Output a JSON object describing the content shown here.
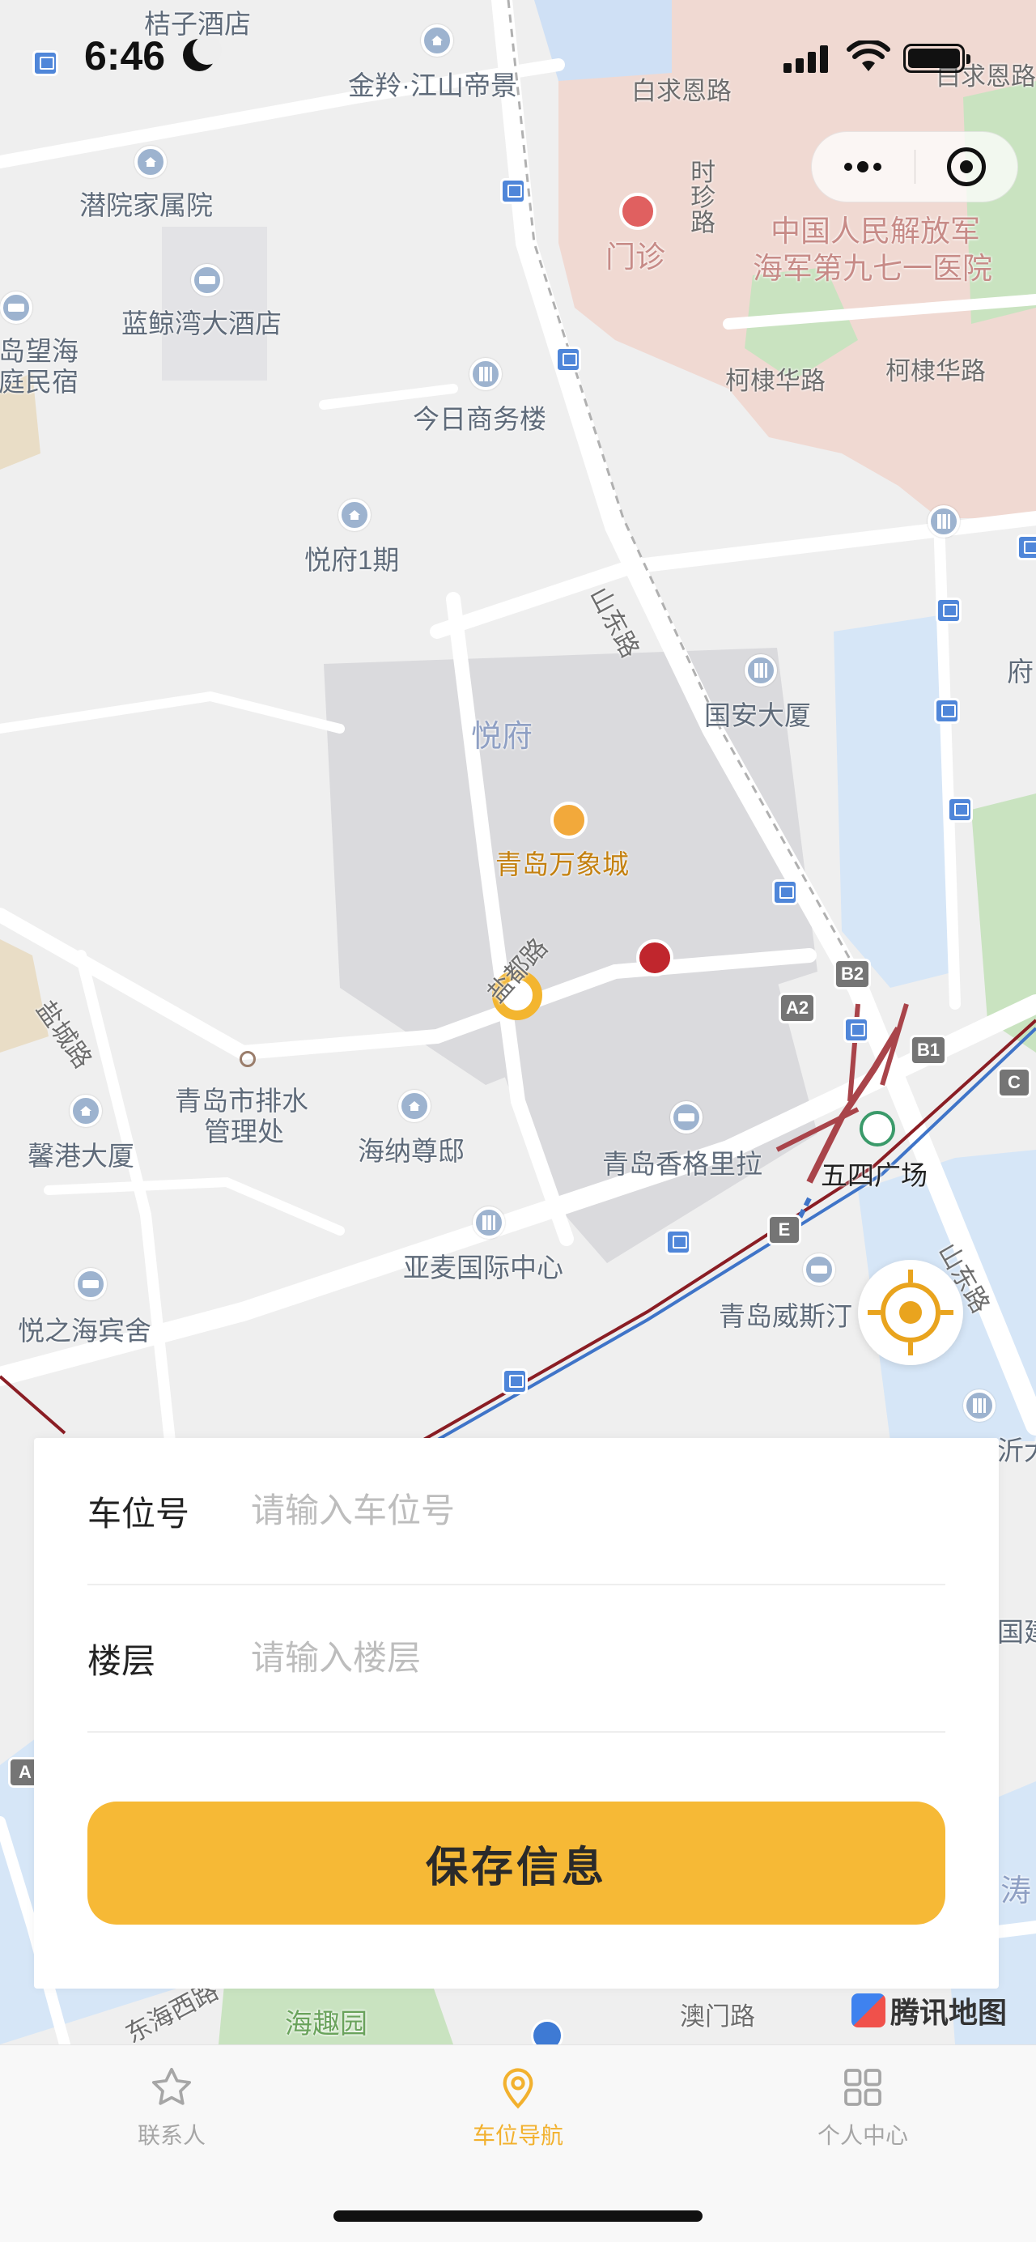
{
  "status_bar": {
    "time": "6:46"
  },
  "map": {
    "labels": {
      "p1": "桔子酒店",
      "p2": "金羚·江山帝景",
      "p3": "白求恩路",
      "p4": "白求恩路",
      "p5": "潜院家属院",
      "p6": "时珍路",
      "p7": "门诊",
      "p8": "中国人民解放军",
      "p9": "海军第九七一医院",
      "p10": "蓝鲸湾大酒店",
      "p11": "岛望海",
      "p12": "庭民宿",
      "p13": "柯棣华路",
      "p14": "柯棣华路",
      "p15": "今日商务楼",
      "p16": "悦府1期",
      "p17": "山东路",
      "p18": "府",
      "p19": "国安大厦",
      "p20": "悦府",
      "p21": "青岛万象城",
      "p22": "盐都路",
      "p23": "盐城路",
      "p24": "青岛市排水",
      "p25": "管理处",
      "p26": "馨港大厦",
      "p27": "海纳尊邸",
      "p28": "青岛香格里拉",
      "p29": "五四广场",
      "p30": "亚麦国际中心",
      "p31": "悦之海宾舍",
      "p32": "青岛威斯汀",
      "p33": "山东路",
      "p34": "沂大",
      "p35": "国建",
      "p36": "涛",
      "p37": "海趣园",
      "p38": "澳门路",
      "p39": "东海西路"
    },
    "metro": {
      "a2": "A2",
      "b2": "B2",
      "b1": "B1",
      "c": "C",
      "e": "E",
      "a": "A"
    },
    "attribution": "腾讯地图"
  },
  "form": {
    "space_label": "车位号",
    "space_placeholder": "请输入车位号",
    "space_value": "",
    "floor_label": "楼层",
    "floor_placeholder": "请输入楼层",
    "floor_value": "",
    "save_label": "保存信息"
  },
  "tabbar": {
    "tabs": [
      {
        "label": "联系人",
        "icon": "star-icon",
        "active": false
      },
      {
        "label": "车位导航",
        "icon": "location-pin-icon",
        "active": true
      },
      {
        "label": "个人中心",
        "icon": "grid-icon",
        "active": false
      }
    ]
  },
  "colors": {
    "accent": "#f6b936",
    "tab_active": "#f2b12e",
    "inactive": "#a6a6a6"
  }
}
